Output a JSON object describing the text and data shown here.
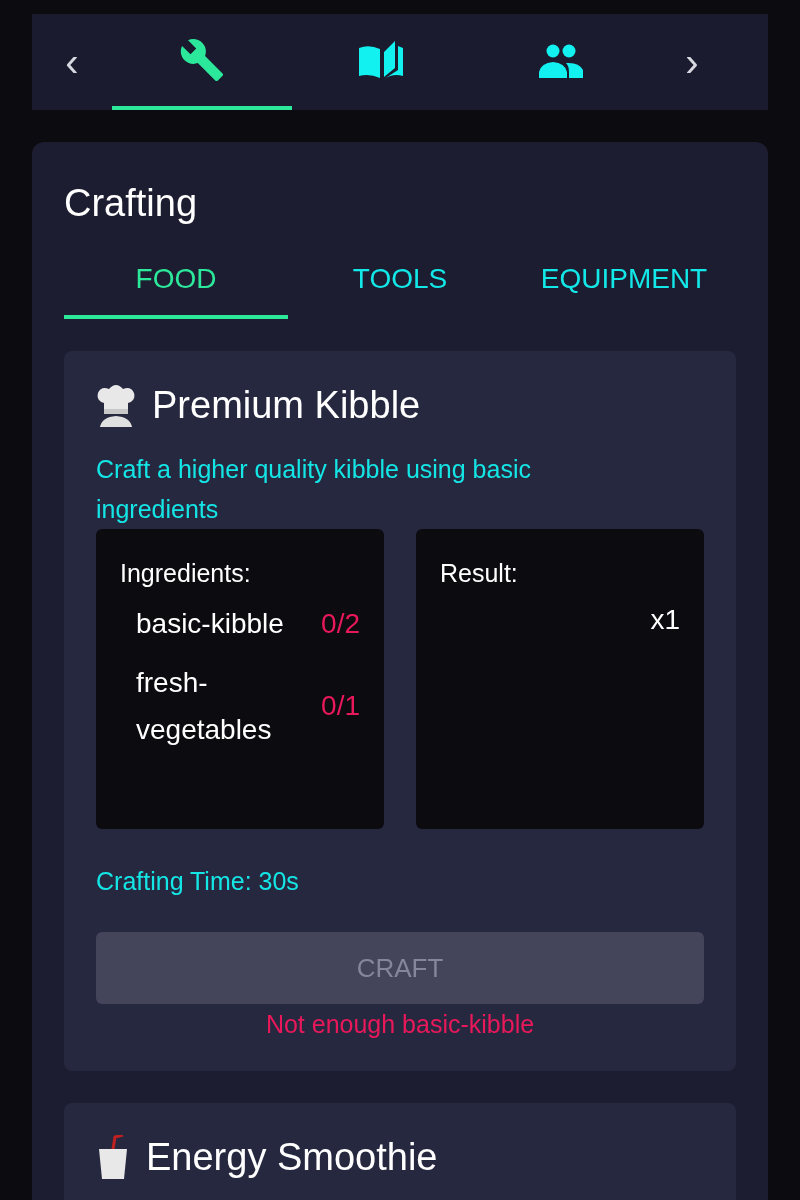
{
  "nav": {
    "prev": "‹",
    "next": "›",
    "tabs": [
      {
        "selected": true
      },
      {
        "selected": false
      },
      {
        "selected": false
      }
    ]
  },
  "panel": {
    "title": "Crafting",
    "categories": [
      {
        "label": "FOOD",
        "selected": true
      },
      {
        "label": "TOOLS",
        "selected": false
      },
      {
        "label": "EQUIPMENT",
        "selected": false
      }
    ]
  },
  "recipes": [
    {
      "title": "Premium Kibble",
      "description": "Craft a higher quality kibble using basic ingredients",
      "ingredients_label": "Ingredients:",
      "ingredients": [
        {
          "name": "basic-kibble",
          "count": "0/2",
          "met": false
        },
        {
          "name": "fresh-vegetables",
          "count": "0/1",
          "met": false
        }
      ],
      "result_label": "Result:",
      "result_quantity": "x1",
      "time": "Crafting Time: 30s",
      "button": {
        "label": "CRAFT",
        "disabled": true
      },
      "error": "Not enough basic-kibble"
    },
    {
      "title": "Energy Smoothie"
    }
  ]
}
